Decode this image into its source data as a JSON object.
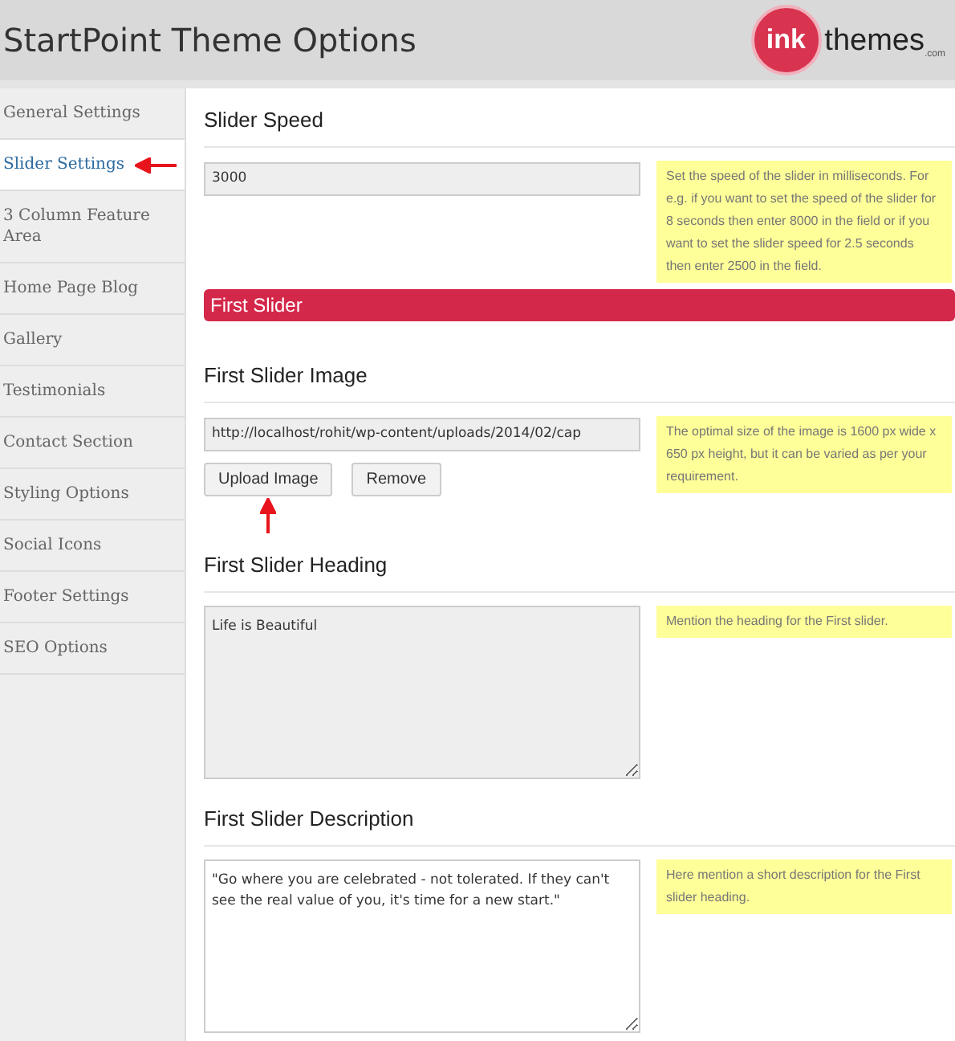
{
  "header": {
    "title": "StartPoint Theme Options",
    "logo": {
      "mark": "ink",
      "word": "themes",
      "suffix": ".com"
    }
  },
  "sidebar": {
    "items": [
      {
        "label": "General Settings",
        "selected": false,
        "arrow": false
      },
      {
        "label": "Slider Settings",
        "selected": true,
        "arrow": true
      },
      {
        "label": "3 Column Feature Area",
        "selected": false,
        "arrow": false
      },
      {
        "label": "Home Page Blog",
        "selected": false,
        "arrow": false
      },
      {
        "label": "Gallery",
        "selected": false,
        "arrow": false
      },
      {
        "label": "Testimonials",
        "selected": false,
        "arrow": false
      },
      {
        "label": "Contact Section",
        "selected": false,
        "arrow": false
      },
      {
        "label": "Styling Options",
        "selected": false,
        "arrow": false
      },
      {
        "label": "Social Icons",
        "selected": false,
        "arrow": false
      },
      {
        "label": "Footer Settings",
        "selected": false,
        "arrow": false
      },
      {
        "label": "SEO Options",
        "selected": false,
        "arrow": false
      }
    ]
  },
  "sections": [
    {
      "kind": "field",
      "title": "Slider Speed",
      "value": "3000",
      "hint": "Set the speed of the slider in milliseconds. For e.g. if you want to set the speed of the slider for 8 seconds then enter 8000 in the field or if you want to set the slider speed for 2.5 seconds then enter 2500 in the field."
    },
    {
      "kind": "banner",
      "title": "First Slider"
    },
    {
      "kind": "upload",
      "title": "First Slider Image",
      "value": "http://localhost/rohit/wp-content/uploads/2014/02/cap",
      "hint": "The optimal size of the image is 1600 px wide x 650 px height, but it can be varied as per your requirement.",
      "buttons": [
        {
          "label": "Upload Image",
          "arrow": true
        },
        {
          "label": "Remove",
          "arrow": false
        }
      ]
    },
    {
      "kind": "textarea",
      "title": "First Slider Heading",
      "value": "Life is Beautiful",
      "hint": "Mention the heading for the First slider."
    },
    {
      "kind": "textarea",
      "title": "First Slider Description",
      "value": "\"Go where you are celebrated - not tolerated. If they can't see the real value of you, it's time for a new start.\"",
      "hint": "Here mention a short description for the First slider heading."
    }
  ]
}
